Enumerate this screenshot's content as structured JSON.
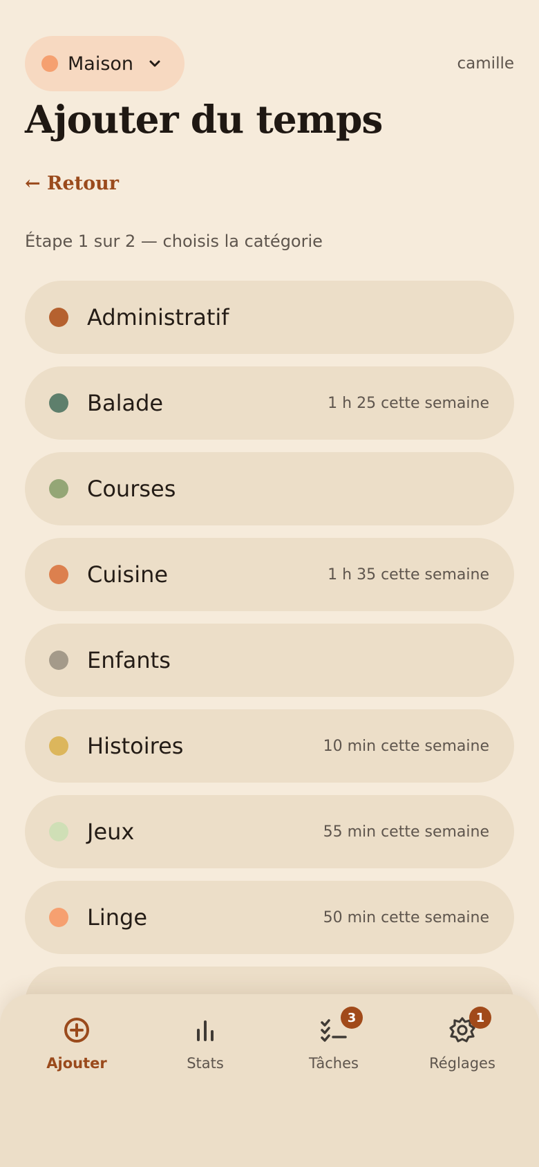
{
  "header": {
    "household_name": "Maison",
    "household_color": "#f5a070",
    "user": "camille",
    "title": "Ajouter du temps",
    "back_label": "← Retour",
    "step_text": "Étape 1 sur 2 — choisis la catégorie"
  },
  "categories": [
    {
      "name": "Administratif",
      "color": "#b5612f",
      "stat": ""
    },
    {
      "name": "Balade",
      "color": "#5e7f6c",
      "stat": "1 h 25 cette semaine"
    },
    {
      "name": "Courses",
      "color": "#94a676",
      "stat": ""
    },
    {
      "name": "Cuisine",
      "color": "#dc804e",
      "stat": "1 h 35 cette semaine"
    },
    {
      "name": "Enfants",
      "color": "#a49a8a",
      "stat": ""
    },
    {
      "name": "Histoires",
      "color": "#dcb65c",
      "stat": "10 min cette semaine"
    },
    {
      "name": "Jeux",
      "color": "#cfdfb6",
      "stat": "55 min cette semaine"
    },
    {
      "name": "Linge",
      "color": "#f6a070",
      "stat": "50 min cette semaine"
    }
  ],
  "nav": {
    "items": [
      {
        "label": "Ajouter",
        "icon": "add-circle-icon",
        "active": true
      },
      {
        "label": "Stats",
        "icon": "bar-chart-icon",
        "active": false
      },
      {
        "label": "Tâches",
        "icon": "checklist-icon",
        "active": false,
        "badge": "3"
      },
      {
        "label": "Réglages",
        "icon": "settings-gear-icon",
        "active": false,
        "badge": "1"
      }
    ]
  },
  "colors": {
    "accent": "#9a4a1c",
    "background": "#f6ebdb",
    "card": "#ecdec8"
  }
}
